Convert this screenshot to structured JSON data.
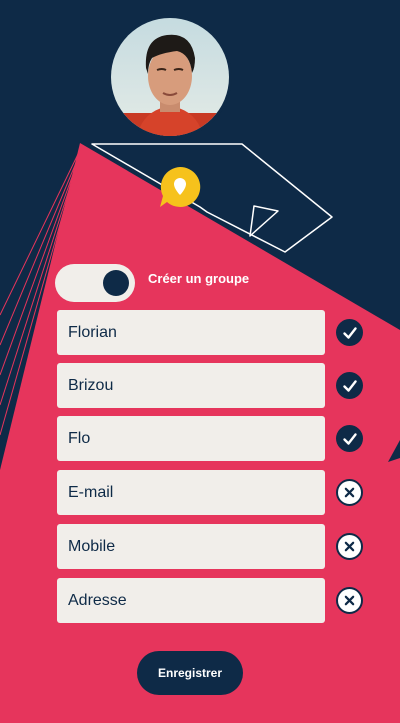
{
  "form": {
    "toggle_label": "Créer un groupe",
    "toggle_on": true,
    "fields": [
      {
        "value": "Florian",
        "status": "valid"
      },
      {
        "value": "Brizou",
        "status": "valid"
      },
      {
        "value": "Flo",
        "status": "valid"
      },
      {
        "value": "E-mail",
        "status": "invalid"
      },
      {
        "value": "Mobile",
        "status": "invalid"
      },
      {
        "value": "Adresse",
        "status": "invalid"
      }
    ],
    "save_label": "Enregistrer"
  },
  "icons": {
    "avatar": "profile-photo",
    "badge": "location-pin-icon",
    "valid": "check-icon",
    "invalid": "close-icon"
  },
  "colors": {
    "navy": "#0e2a47",
    "pink": "#e6355c",
    "field": "#f1eeea",
    "yellow": "#f6c21c"
  }
}
